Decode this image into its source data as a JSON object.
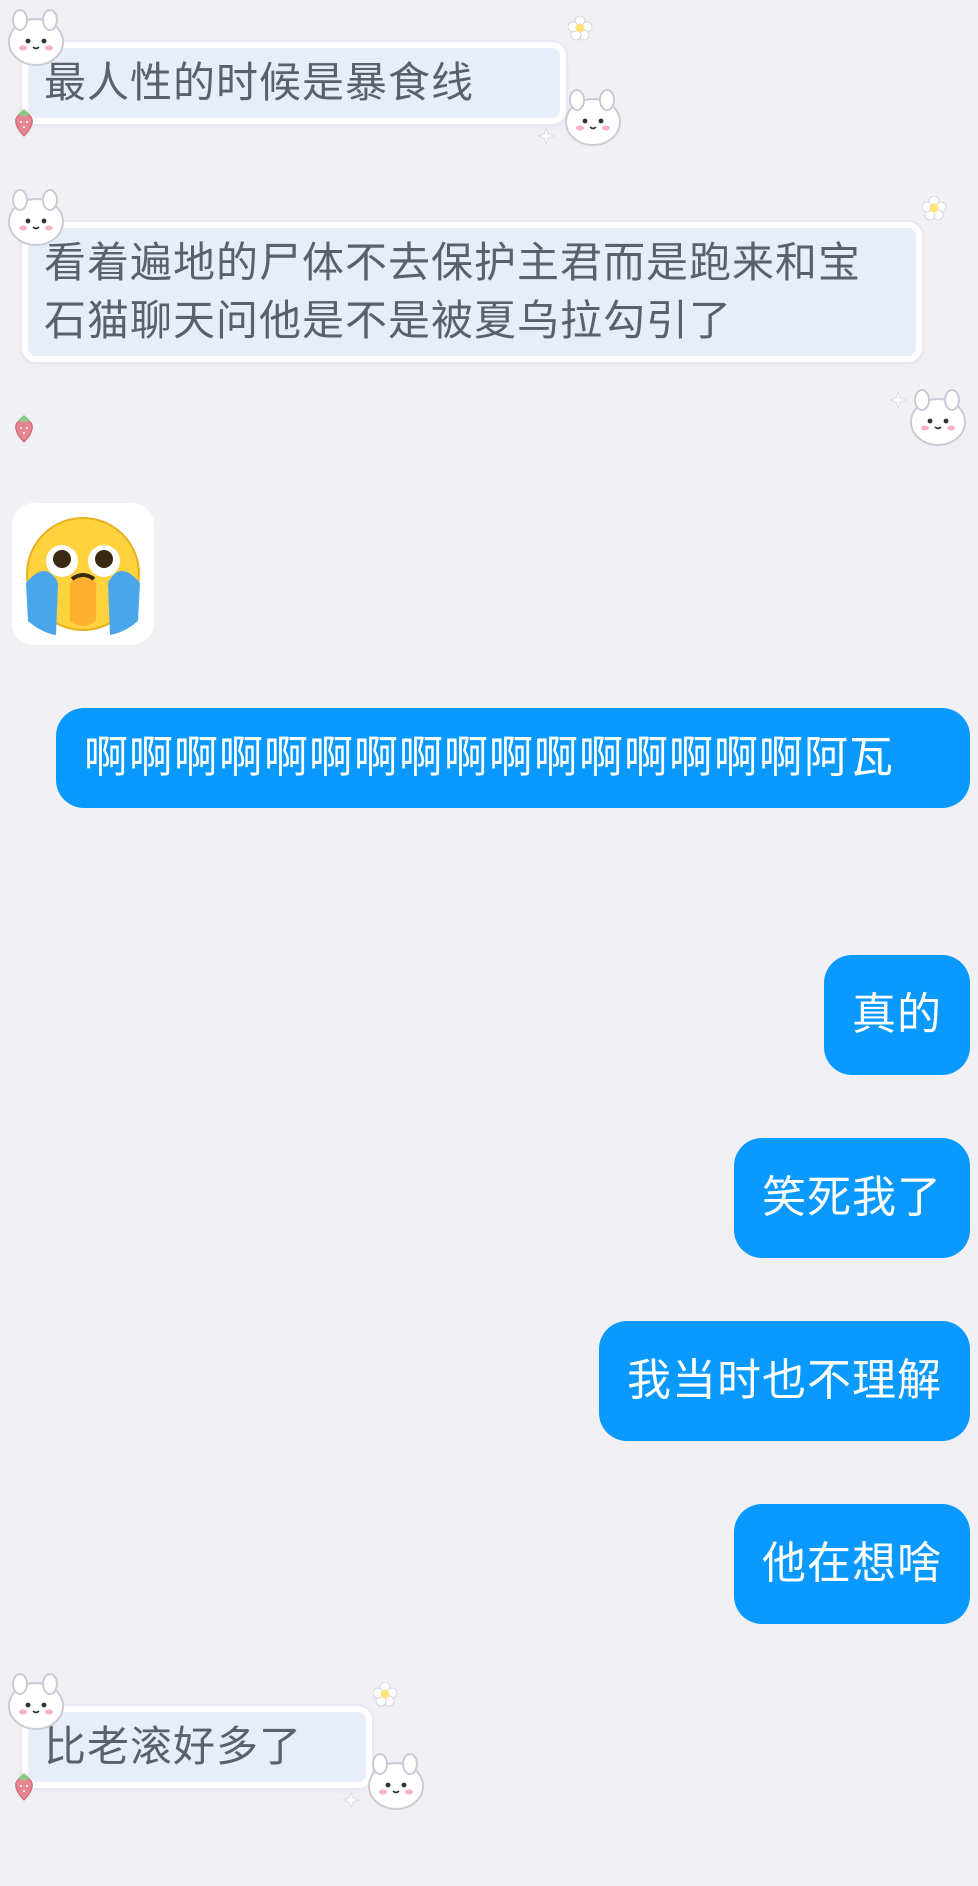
{
  "messages": [
    {
      "id": "m1",
      "direction": "incoming",
      "text": "最人性的时候是暴食线"
    },
    {
      "id": "m2",
      "direction": "incoming",
      "text": "看着遍地的尸体不去保护主君而是跑来和宝石猫聊天问他是不是被夏乌拉勾引了"
    },
    {
      "id": "m3",
      "direction": "incoming",
      "type": "sticker",
      "sticker": "crying-face-emoji"
    },
    {
      "id": "m4",
      "direction": "outgoing",
      "text": "啊啊啊啊啊啊啊啊啊啊啊啊啊啊啊啊阿瓦"
    },
    {
      "id": "m5",
      "direction": "outgoing",
      "text": "真的"
    },
    {
      "id": "m6",
      "direction": "outgoing",
      "text": "笑死我了"
    },
    {
      "id": "m7",
      "direction": "outgoing",
      "text": "我当时也不理解"
    },
    {
      "id": "m8",
      "direction": "outgoing",
      "text": "他在想啥"
    },
    {
      "id": "m9",
      "direction": "incoming",
      "text": "比老滚好多了"
    }
  ],
  "colors": {
    "background": "#f1f1f5",
    "outgoing_bubble": "#0a99ff",
    "incoming_bubble": "#e8eef9",
    "incoming_text": "#5b5f70",
    "outgoing_text": "#ffffff"
  },
  "decorations": [
    "bunny-sticker-icon",
    "flower-icon",
    "strawberry-icon",
    "sparkle-icon",
    "puppy-label"
  ]
}
